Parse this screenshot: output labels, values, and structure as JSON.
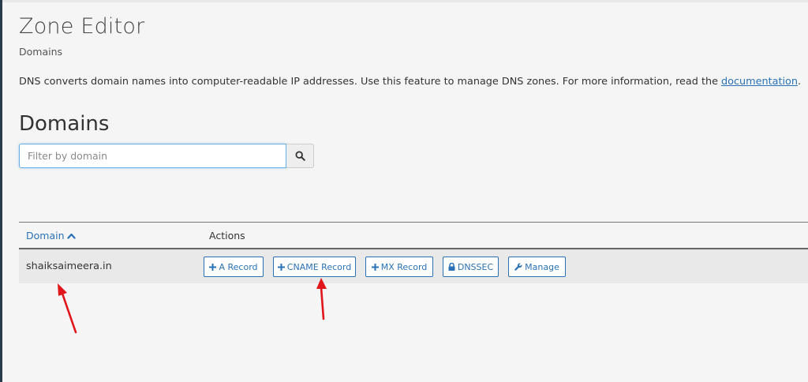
{
  "header": {
    "title": "Zone Editor",
    "breadcrumb": "Domains"
  },
  "description": {
    "text": "DNS converts domain names into computer-readable IP addresses. Use this feature to manage DNS zones. For more information, read the ",
    "link_label": "documentation",
    "suffix": "."
  },
  "section": {
    "title": "Domains"
  },
  "search": {
    "placeholder": "Filter by domain",
    "value": "",
    "button_icon": "search-icon"
  },
  "table": {
    "columns": {
      "domain": "Domain",
      "domain_sort_icon": "chevron-up-icon",
      "actions": "Actions"
    },
    "rows": [
      {
        "domain": "shaiksaimeera.in",
        "actions": [
          {
            "label": "A Record",
            "icon": "plus-icon"
          },
          {
            "label": "CNAME Record",
            "icon": "plus-icon"
          },
          {
            "label": "MX Record",
            "icon": "plus-icon"
          },
          {
            "label": "DNSSEC",
            "icon": "lock-icon"
          },
          {
            "label": "Manage",
            "icon": "wrench-icon"
          }
        ]
      }
    ]
  },
  "annotations": {
    "arrow_color": "#e0161b"
  },
  "colors": {
    "accent": "#2a72b5",
    "sidebar_edge": "#293a4a",
    "row_bg": "#e9e9e9",
    "page_bg": "#f5f5f5"
  }
}
